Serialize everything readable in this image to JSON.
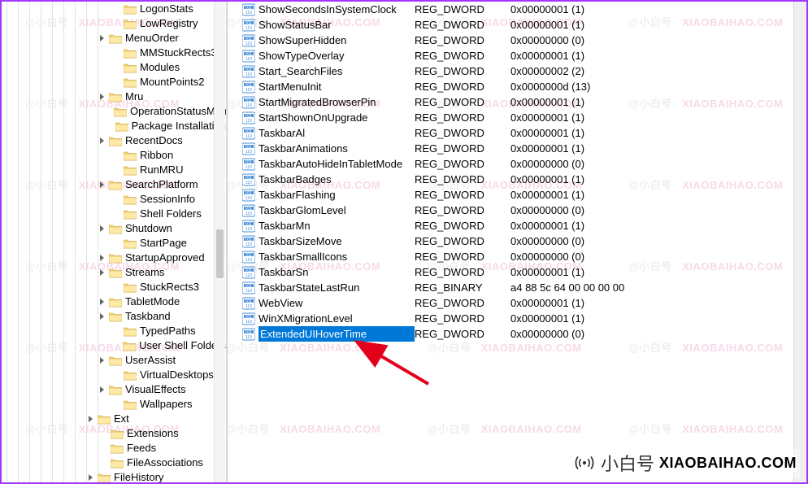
{
  "tree": {
    "guide_lefts": [
      6,
      20,
      34,
      48,
      62,
      76,
      90,
      104,
      118
    ],
    "items": [
      {
        "indent": 136,
        "expander": "",
        "label": "LogonStats"
      },
      {
        "indent": 136,
        "expander": "",
        "label": "LowRegistry"
      },
      {
        "indent": 118,
        "expander": ">",
        "label": "MenuOrder"
      },
      {
        "indent": 136,
        "expander": "",
        "label": "MMStuckRects3"
      },
      {
        "indent": 136,
        "expander": "",
        "label": "Modules"
      },
      {
        "indent": 136,
        "expander": "",
        "label": "MountPoints2"
      },
      {
        "indent": 118,
        "expander": ">",
        "label": "Mru"
      },
      {
        "indent": 136,
        "expander": "",
        "label": "OperationStatusMan"
      },
      {
        "indent": 136,
        "expander": "",
        "label": "Package Installation"
      },
      {
        "indent": 118,
        "expander": ">",
        "label": "RecentDocs"
      },
      {
        "indent": 136,
        "expander": "",
        "label": "Ribbon"
      },
      {
        "indent": 136,
        "expander": "",
        "label": "RunMRU"
      },
      {
        "indent": 118,
        "expander": ">",
        "label": "SearchPlatform"
      },
      {
        "indent": 136,
        "expander": "",
        "label": "SessionInfo"
      },
      {
        "indent": 136,
        "expander": "",
        "label": "Shell Folders"
      },
      {
        "indent": 118,
        "expander": ">",
        "label": "Shutdown"
      },
      {
        "indent": 136,
        "expander": "",
        "label": "StartPage"
      },
      {
        "indent": 118,
        "expander": ">",
        "label": "StartupApproved"
      },
      {
        "indent": 118,
        "expander": ">",
        "label": "Streams"
      },
      {
        "indent": 136,
        "expander": "",
        "label": "StuckRects3"
      },
      {
        "indent": 118,
        "expander": ">",
        "label": "TabletMode"
      },
      {
        "indent": 118,
        "expander": ">",
        "label": "Taskband"
      },
      {
        "indent": 136,
        "expander": "",
        "label": "TypedPaths"
      },
      {
        "indent": 136,
        "expander": "",
        "label": "User Shell Folders"
      },
      {
        "indent": 118,
        "expander": ">",
        "label": "UserAssist"
      },
      {
        "indent": 136,
        "expander": "",
        "label": "VirtualDesktops"
      },
      {
        "indent": 118,
        "expander": ">",
        "label": "VisualEffects"
      },
      {
        "indent": 136,
        "expander": "",
        "label": "Wallpapers"
      },
      {
        "indent": 104,
        "expander": ">",
        "label": "Ext",
        "current": true
      },
      {
        "indent": 120,
        "expander": "",
        "label": "Extensions"
      },
      {
        "indent": 120,
        "expander": "",
        "label": "Feeds"
      },
      {
        "indent": 120,
        "expander": "",
        "label": "FileAssociations"
      },
      {
        "indent": 104,
        "expander": ">",
        "label": "FileHistory"
      }
    ]
  },
  "values": [
    {
      "name": "ShowSecondsInSystemClock",
      "type": "REG_DWORD",
      "data": "0x00000001 (1)"
    },
    {
      "name": "ShowStatusBar",
      "type": "REG_DWORD",
      "data": "0x00000001 (1)"
    },
    {
      "name": "ShowSuperHidden",
      "type": "REG_DWORD",
      "data": "0x00000000 (0)"
    },
    {
      "name": "ShowTypeOverlay",
      "type": "REG_DWORD",
      "data": "0x00000001 (1)"
    },
    {
      "name": "Start_SearchFiles",
      "type": "REG_DWORD",
      "data": "0x00000002 (2)"
    },
    {
      "name": "StartMenuInit",
      "type": "REG_DWORD",
      "data": "0x0000000d (13)"
    },
    {
      "name": "StartMigratedBrowserPin",
      "type": "REG_DWORD",
      "data": "0x00000001 (1)"
    },
    {
      "name": "StartShownOnUpgrade",
      "type": "REG_DWORD",
      "data": "0x00000001 (1)"
    },
    {
      "name": "TaskbarAl",
      "type": "REG_DWORD",
      "data": "0x00000001 (1)"
    },
    {
      "name": "TaskbarAnimations",
      "type": "REG_DWORD",
      "data": "0x00000001 (1)"
    },
    {
      "name": "TaskbarAutoHideInTabletMode",
      "type": "REG_DWORD",
      "data": "0x00000000 (0)"
    },
    {
      "name": "TaskbarBadges",
      "type": "REG_DWORD",
      "data": "0x00000001 (1)"
    },
    {
      "name": "TaskbarFlashing",
      "type": "REG_DWORD",
      "data": "0x00000001 (1)"
    },
    {
      "name": "TaskbarGlomLevel",
      "type": "REG_DWORD",
      "data": "0x00000000 (0)"
    },
    {
      "name": "TaskbarMn",
      "type": "REG_DWORD",
      "data": "0x00000001 (1)"
    },
    {
      "name": "TaskbarSizeMove",
      "type": "REG_DWORD",
      "data": "0x00000000 (0)"
    },
    {
      "name": "TaskbarSmallIcons",
      "type": "REG_DWORD",
      "data": "0x00000000 (0)"
    },
    {
      "name": "TaskbarSn",
      "type": "REG_DWORD",
      "data": "0x00000001 (1)"
    },
    {
      "name": "TaskbarStateLastRun",
      "type": "REG_BINARY",
      "data": "a4 88 5c 64 00 00 00 00"
    },
    {
      "name": "WebView",
      "type": "REG_DWORD",
      "data": "0x00000001 (1)"
    },
    {
      "name": "WinXMigrationLevel",
      "type": "REG_DWORD",
      "data": "0x00000001 (1)"
    },
    {
      "name": "ExtendedUIHoverTime",
      "type": "REG_DWORD",
      "data": "0x00000000 (0)",
      "selected": true
    }
  ],
  "footer": {
    "cn": "小白号",
    "en": "XIAOBAIHAO.COM"
  }
}
